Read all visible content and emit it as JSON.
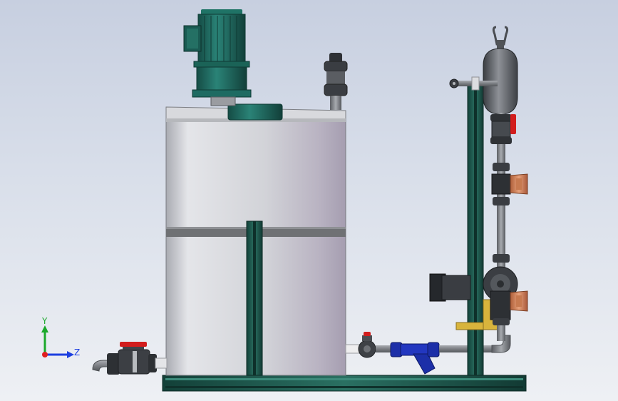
{
  "triad": {
    "y_label": "Y",
    "z_label": "Z",
    "colors": {
      "y": "#1aa82a",
      "z": "#1c3fe0",
      "x": "#e02020"
    }
  },
  "colors": {
    "background_top": "#c7cfe0",
    "background_bottom": "#eef0f4",
    "tank_body": "#cfd0d6",
    "tank_band": "#6f7174",
    "motor_green": "#1e6b62",
    "frame_green": "#1d5a50",
    "pipe_grey": "#8c8f93",
    "valve_dark": "#3a3d42",
    "valve_red": "#d21d1d",
    "filter_blue": "#1c2fa8",
    "pump_copper": "#d48456",
    "bracket_yellow": "#d8b43c"
  }
}
